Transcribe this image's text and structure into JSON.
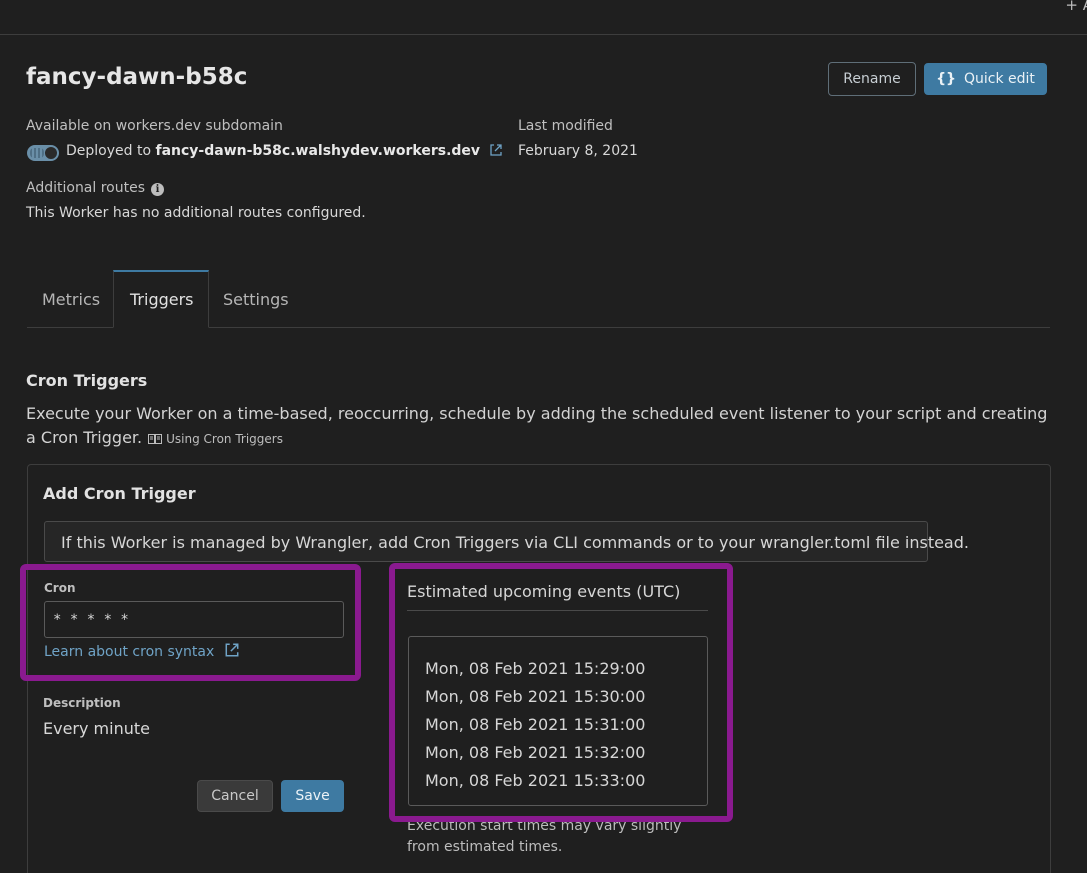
{
  "topbar": {
    "add_label": "+ A"
  },
  "header": {
    "title": "fancy-dawn-b58c",
    "rename_label": "Rename",
    "quick_edit_icon": "{}",
    "quick_edit_label": "Quick edit"
  },
  "info": {
    "subdomain_label": "Available on workers.dev subdomain",
    "deployed_prefix": "Deployed to",
    "deployed_url": "fancy-dawn-b58c.walshydev.workers.dev",
    "last_modified_label": "Last modified",
    "last_modified_value": "February 8, 2021",
    "routes_label": "Additional routes",
    "routes_value": "This Worker has no additional routes configured.",
    "toggle_on": true
  },
  "tabs": [
    {
      "label": "Metrics",
      "active": false
    },
    {
      "label": "Triggers",
      "active": true
    },
    {
      "label": "Settings",
      "active": false
    }
  ],
  "cron_triggers": {
    "heading": "Cron Triggers",
    "description": "Execute your Worker on a time-based, reoccurring, schedule by adding the scheduled event listener to your script and creating a Cron Trigger.",
    "doc_link": "Using Cron Triggers",
    "card": {
      "heading": "Add Cron Trigger",
      "notice": "If this Worker is managed by Wrangler, add Cron Triggers via CLI commands or to your wrangler.toml file instead.",
      "cron_label": "Cron",
      "cron_value": "* * * * *",
      "cron_link": "Learn about cron syntax",
      "description_label": "Description",
      "description_value": "Every minute",
      "cancel_label": "Cancel",
      "save_label": "Save",
      "events_heading": "Estimated upcoming events (UTC)",
      "events": [
        "Mon, 08 Feb 2021 15:29:00",
        "Mon, 08 Feb 2021 15:30:00",
        "Mon, 08 Feb 2021 15:31:00",
        "Mon, 08 Feb 2021 15:32:00",
        "Mon, 08 Feb 2021 15:33:00"
      ],
      "events_note": "Execution start times may vary slightly from estimated times."
    }
  },
  "colors": {
    "background": "#1f1f1f",
    "accent": "#3e7aa2",
    "link": "#6fa3c6",
    "highlight": "#8a1a8f"
  }
}
